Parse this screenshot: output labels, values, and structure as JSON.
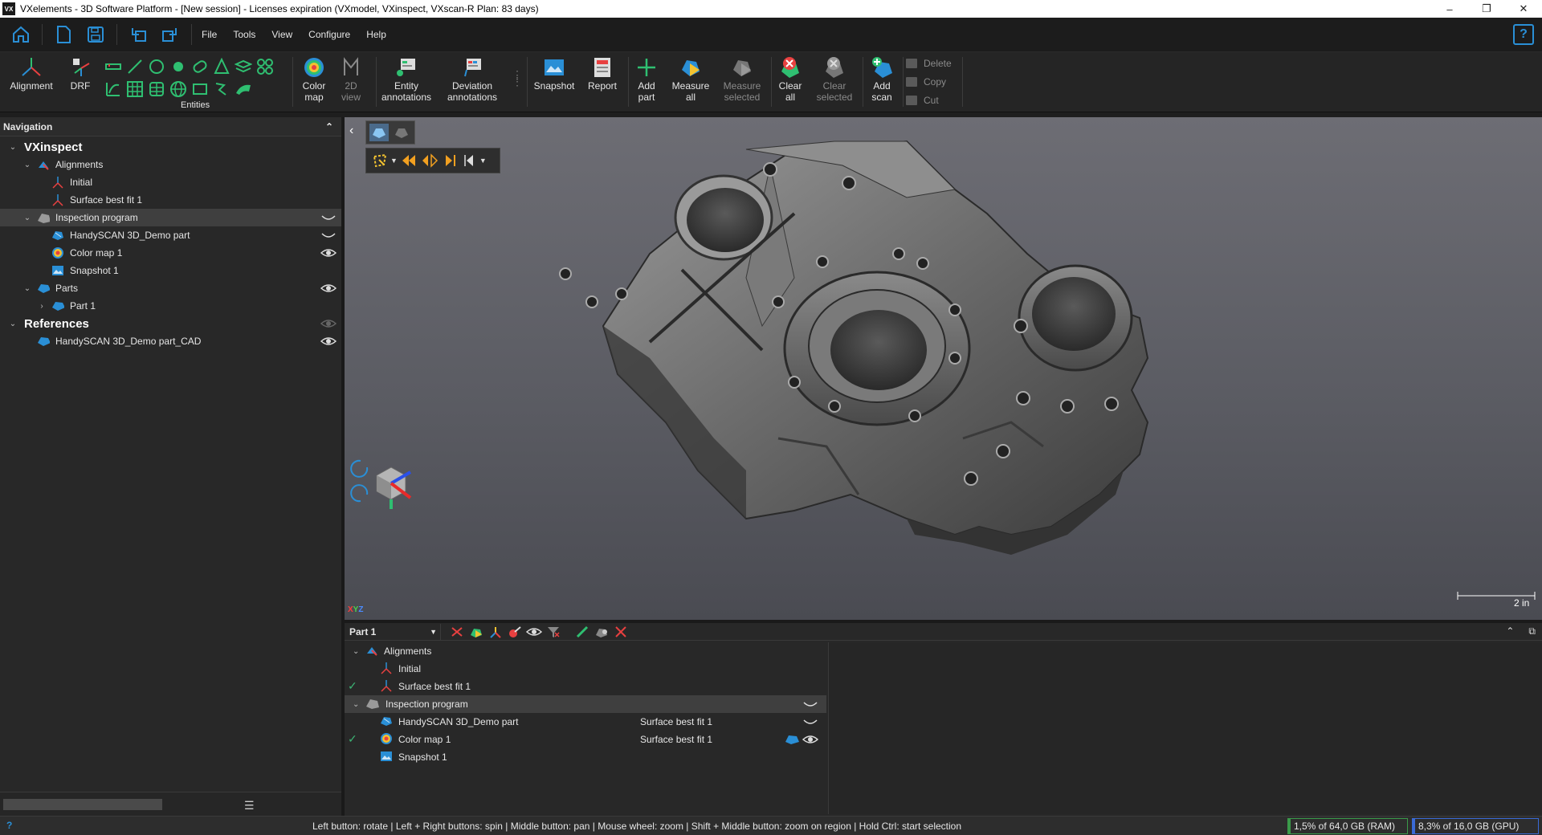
{
  "window": {
    "title": "VXelements - 3D Software Platform - [New session] - Licenses expiration (VXmodel, VXinspect, VXscan-R Plan: 83 days)",
    "app_icon_text": "VX",
    "minimize": "–",
    "restore": "❐",
    "close": "✕"
  },
  "menu": {
    "items": [
      "File",
      "Tools",
      "View",
      "Configure",
      "Help"
    ],
    "help_icon": "?"
  },
  "ribbon": {
    "alignment": "Alignment",
    "drf": "DRF",
    "entities_label": "Entities",
    "color_map": "Color\nmap",
    "view_2d": "2D\nview",
    "entity_annotations": "Entity\nannotations",
    "deviation_annotations": "Deviation\nannotations",
    "snapshot": "Snapshot",
    "report": "Report",
    "add_part": "Add\npart",
    "measure_all": "Measure\nall",
    "measure_selected": "Measure\nselected",
    "clear_all": "Clear\nall",
    "clear_selected": "Clear\nselected",
    "add_scan": "Add\nscan",
    "delete": "Delete",
    "copy": "Copy",
    "cut": "Cut"
  },
  "navigation": {
    "header": "Navigation",
    "collapse": "⌃",
    "rows": [
      {
        "label": "VXinspect",
        "level": 0,
        "big": true,
        "expanded": true
      },
      {
        "label": "Alignments",
        "level": 1,
        "expanded": true
      },
      {
        "label": "Initial",
        "level": 2
      },
      {
        "label": "Surface best fit 1",
        "level": 2
      },
      {
        "label": "Inspection program",
        "level": 1,
        "expanded": true,
        "selected": true
      },
      {
        "label": "HandySCAN 3D_Demo part",
        "level": 2
      },
      {
        "label": "Color map 1",
        "level": 2
      },
      {
        "label": "Snapshot 1",
        "level": 2
      },
      {
        "label": "Parts",
        "level": 1,
        "expanded": true
      },
      {
        "label": "Part 1",
        "level": 2,
        "collapsed": true
      },
      {
        "label": "References",
        "level": 0,
        "big": true,
        "expanded": true
      },
      {
        "label": "HandySCAN 3D_Demo part_CAD",
        "level": 1
      }
    ]
  },
  "viewport": {
    "back": "‹",
    "scale_label": "2 in",
    "axes": [
      "X",
      "Y",
      "Z"
    ]
  },
  "bottom_panel": {
    "part_select": "Part 1",
    "rows": [
      {
        "label": "Alignments",
        "level": 0,
        "expanded": true,
        "check": false,
        "col2": ""
      },
      {
        "label": "Initial",
        "level": 1,
        "check": false,
        "col2": ""
      },
      {
        "label": "Surface best fit 1",
        "level": 1,
        "check": true,
        "col2": ""
      },
      {
        "label": "Inspection program",
        "level": 0,
        "expanded": true,
        "selected": true,
        "check": false,
        "col2": ""
      },
      {
        "label": "HandySCAN 3D_Demo part",
        "level": 1,
        "check": false,
        "col2": "Surface best fit 1"
      },
      {
        "label": "Color map 1",
        "level": 1,
        "check": true,
        "col2": "Surface best fit 1"
      },
      {
        "label": "Snapshot 1",
        "level": 1,
        "check": false,
        "col2": ""
      }
    ]
  },
  "status": {
    "help": "?",
    "hint": "Left button: rotate  |  Left + Right buttons: spin  |  Middle button: pan  |  Mouse wheel: zoom  |  Shift + Middle button: zoom on region  |  Hold Ctrl: start selection",
    "ram": "1,5% of 64,0 GB (RAM)",
    "gpu": "8,3% of 16,0 GB (GPU)"
  },
  "colors": {
    "accent_blue": "#2a8fd6",
    "entity_green": "#2fbf71",
    "ram_green": "#3a9a4a",
    "gpu_blue": "#3a6ad6"
  }
}
